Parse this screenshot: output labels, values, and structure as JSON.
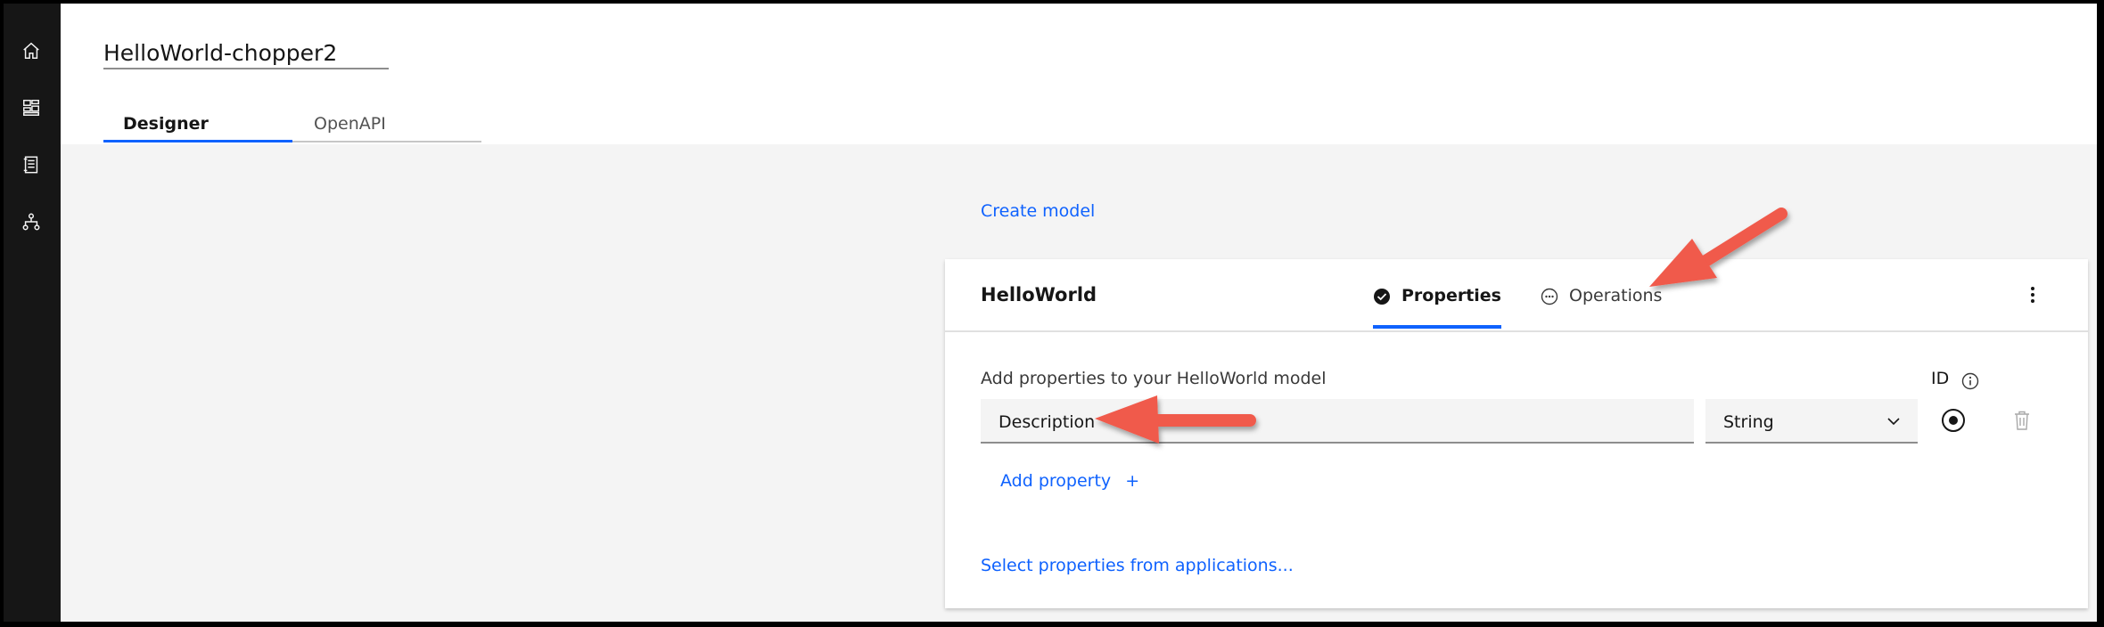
{
  "rail": {
    "icons": [
      "home-icon",
      "dashboard-icon",
      "catalog-icon",
      "hierarchy-icon"
    ]
  },
  "header": {
    "app_title": "HelloWorld-chopper2",
    "tabs": [
      {
        "label": "Designer",
        "active": true
      },
      {
        "label": "OpenAPI",
        "active": false
      }
    ]
  },
  "main": {
    "create_model_link": "Create model",
    "model": {
      "name": "HelloWorld",
      "tabs": [
        {
          "label": "Properties",
          "active": true,
          "icon": "checkmark-filled-icon"
        },
        {
          "label": "Operations",
          "active": false,
          "icon": "overflow-circle-icon"
        }
      ],
      "properties_label": "Add properties to your HelloWorld model",
      "id_label": "ID",
      "properties": [
        {
          "name": "Description",
          "type": "String",
          "is_id": true
        }
      ],
      "add_property_label": "Add property",
      "add_property_icon": "+",
      "select_from_apps_link": "Select properties from applications..."
    }
  },
  "colors": {
    "accent": "#0f62fe",
    "annotation_arrow": "#f05a4b",
    "rail_bg": "#161616",
    "canvas_bg": "#f4f4f4"
  }
}
